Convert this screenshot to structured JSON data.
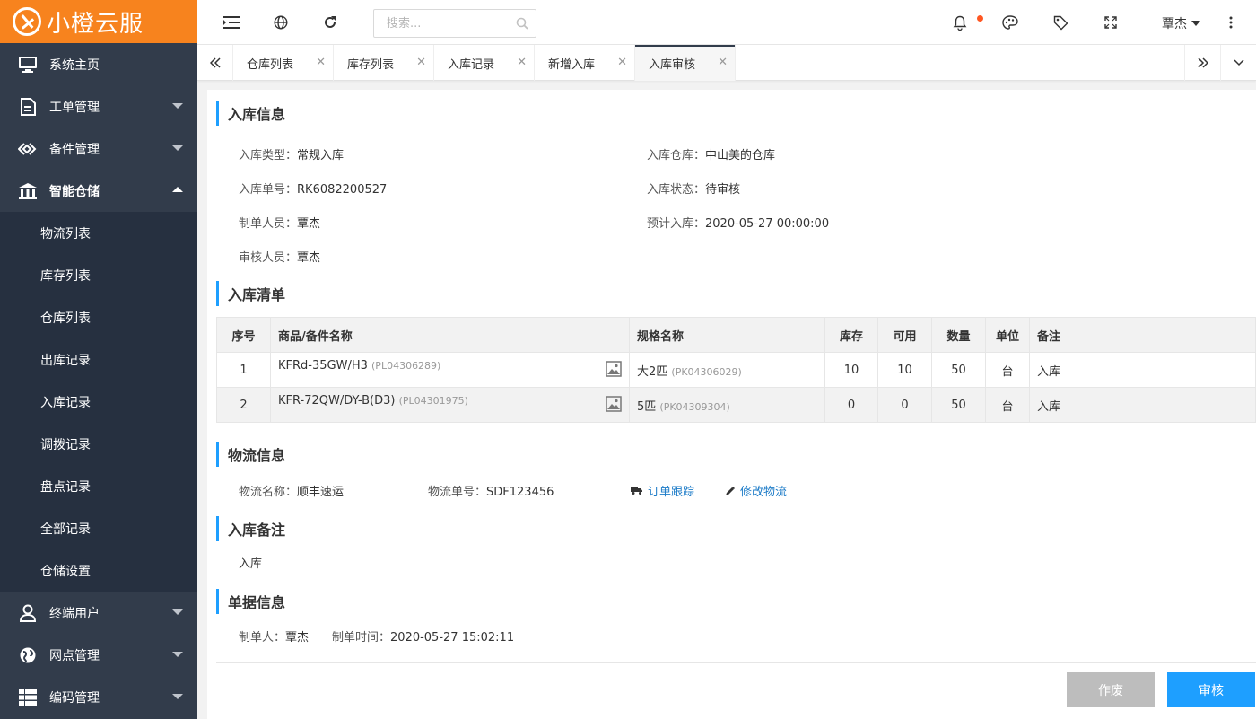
{
  "app": {
    "name": "小橙云服",
    "brand_color": "#f7831e",
    "sidebar_color": "#323c4b",
    "accent_color": "#1e9fff"
  },
  "sidebar": {
    "items": [
      {
        "label": "系统主页",
        "icon": "monitor-icon"
      },
      {
        "label": "工单管理",
        "icon": "document-icon"
      },
      {
        "label": "备件管理",
        "icon": "diamond-icon"
      },
      {
        "label": "智能仓储",
        "icon": "bank-icon"
      },
      {
        "label": "终端用户",
        "icon": "user-icon"
      },
      {
        "label": "网点管理",
        "icon": "globe-icon"
      },
      {
        "label": "编码管理",
        "icon": "grid-icon"
      }
    ],
    "submenu": [
      "物流列表",
      "库存列表",
      "仓库列表",
      "出库记录",
      "入库记录",
      "调拨记录",
      "盘点记录",
      "全部记录",
      "仓储设置"
    ]
  },
  "topbar": {
    "search_placeholder": "搜索...",
    "user_name": "覃杰"
  },
  "tabs": [
    {
      "label": "仓库列表"
    },
    {
      "label": "库存列表"
    },
    {
      "label": "入库记录"
    },
    {
      "label": "新增入库"
    },
    {
      "label": "入库审核"
    }
  ],
  "inbound_info": {
    "title": "入库信息",
    "type_label": "入库类型：",
    "type_value": "常规入库",
    "warehouse_label": "入库仓库：",
    "warehouse_value": "中山美的仓库",
    "number_label": "入库单号：",
    "number_value": "RK6082200527",
    "status_label": "入库状态：",
    "status_value": "待审核",
    "creator_label": "制单人员：",
    "creator_value": "覃杰",
    "expected_label": "预计入库：",
    "expected_value": "2020-05-27 00:00:00",
    "auditor_label": "审核人员：",
    "auditor_value": "覃杰"
  },
  "inbound_list": {
    "title": "入库清单",
    "headers": [
      "序号",
      "商品/备件名称",
      "规格名称",
      "库存",
      "可用",
      "数量",
      "单位",
      "备注"
    ],
    "rows": [
      {
        "no": "1",
        "name": "KFRd-35GW/H3",
        "name_code": "(PL04306289)",
        "spec": "大2匹",
        "spec_code": "(PK04306029)",
        "stock": "10",
        "available": "10",
        "qty": "50",
        "unit": "台",
        "remark": "入库"
      },
      {
        "no": "2",
        "name": "KFR-72QW/DY-B(D3)",
        "name_code": "(PL04301975)",
        "spec": "5匹",
        "spec_code": "(PK04309304)",
        "stock": "0",
        "available": "0",
        "qty": "50",
        "unit": "台",
        "remark": "入库"
      }
    ]
  },
  "logistics": {
    "title": "物流信息",
    "name_label": "物流名称：",
    "name_value": "顺丰速运",
    "number_label": "物流单号：",
    "number_value": "SDF123456",
    "track_link": "订单跟踪",
    "edit_link": "修改物流"
  },
  "remark": {
    "title": "入库备注",
    "text": "入库"
  },
  "doc_info": {
    "title": "单据信息",
    "creator_label": "制单人：",
    "creator_value": "覃杰",
    "time_label": "制单时间：",
    "time_value": "2020-05-27 15:02:11"
  },
  "actions": {
    "void_label": "作废",
    "audit_label": "审核"
  }
}
